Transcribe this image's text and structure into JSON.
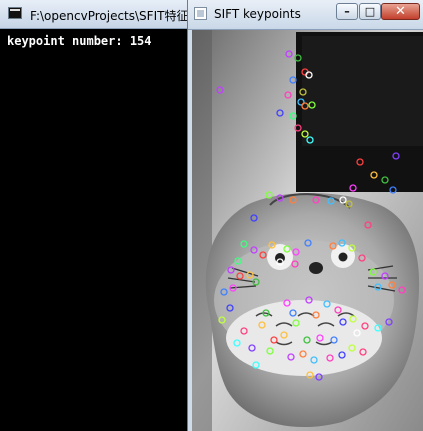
{
  "console_window": {
    "title": "F:\\opencvProjects\\SFIT特征",
    "output": "keypoint number: 154"
  },
  "image_window": {
    "title": "SIFT keypoints",
    "controls": {
      "minimize": "–",
      "maximize": "□",
      "close": "✕"
    }
  },
  "colors": {
    "console_bg": "#000000",
    "console_text": "#ffffff",
    "titlebar": "#c9d8e8",
    "close_button": "#c13f2b"
  }
}
